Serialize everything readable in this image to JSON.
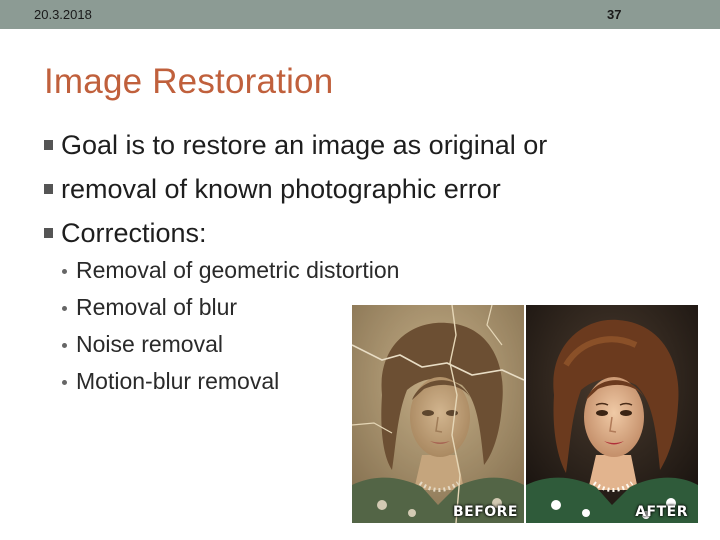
{
  "header": {
    "date": "20.3.2018",
    "page_number": "37"
  },
  "slide": {
    "title": "Image Restoration",
    "bullets": [
      "Goal is to restore an image as original or",
      "removal of known photographic error",
      "Corrections:"
    ],
    "sub_bullets": [
      "Removal of geometric distortion",
      "Removal of blur",
      "Noise removal",
      "Motion-blur removal"
    ]
  },
  "photos": {
    "before_label": "BEFORE",
    "after_label": "AFTER"
  },
  "colors": {
    "header_bar": "#8c9b94",
    "title": "#c0603c",
    "text": "#1e1e1e"
  }
}
